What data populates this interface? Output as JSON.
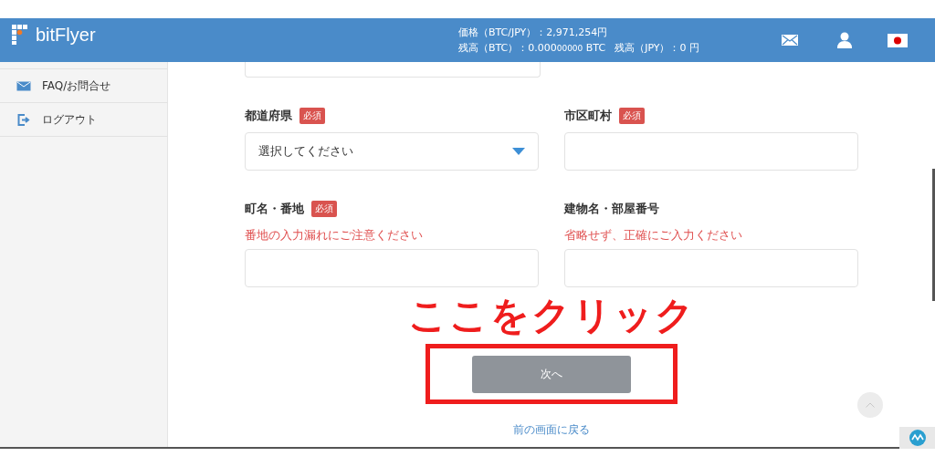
{
  "header": {
    "logo": "bitFlyer",
    "price": "価格（BTC/JPY）：2,971,254円",
    "balance_btc": {
      "label": "残高（BTC）：",
      "value": "0.000",
      "value_small": "00000",
      "unit": "BTC"
    },
    "balance_jpy": "残高（JPY）：0 円"
  },
  "sidebar": {
    "items": [
      {
        "label": "FAQ/お問合せ"
      },
      {
        "label": "ログアウト"
      }
    ]
  },
  "form": {
    "fields": [
      {
        "label": "都道府県",
        "badge": "必須",
        "kind": "select",
        "placeholder": "選択してください"
      },
      {
        "label": "市区町村",
        "badge": "必須",
        "kind": "text"
      },
      {
        "label": "町名・番地",
        "badge": "必須",
        "hint": "番地の入力漏れにご注意ください",
        "kind": "text"
      },
      {
        "label": "建物名・部屋番号",
        "hint": "省略せず、正確にご入力ください",
        "kind": "text"
      }
    ]
  },
  "annotation": {
    "text": "ここをクリック"
  },
  "next_button": {
    "label": "次へ",
    "disabled": true
  },
  "back_link": "前の画面に戻る"
}
